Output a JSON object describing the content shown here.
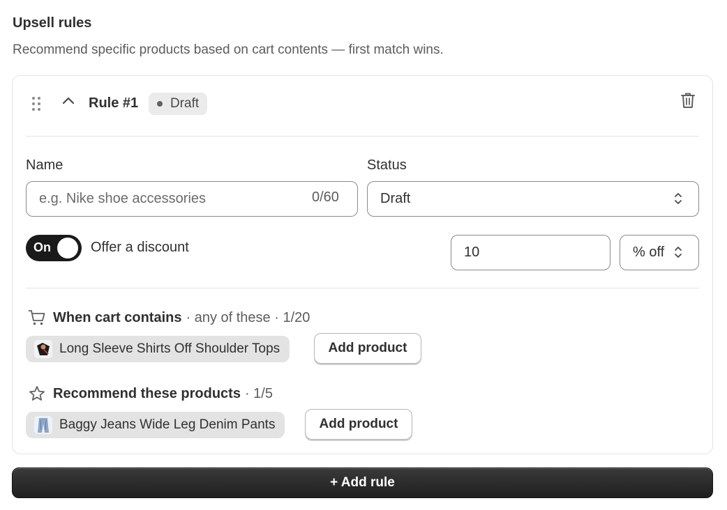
{
  "header": {
    "title": "Upsell rules",
    "subtitle": "Recommend specific products based on cart contents — first match wins."
  },
  "rule": {
    "title": "Rule #1",
    "badge": "Draft",
    "name_label": "Name",
    "name_placeholder": "e.g. Nike shoe accessories",
    "name_counter": "0/60",
    "status_label": "Status",
    "status_value": "Draft",
    "toggle_text": "On",
    "toggle_label": "Offer a discount",
    "discount_value": "10",
    "discount_unit": "% off",
    "cart_section": {
      "title": "When cart contains",
      "meta": "· any of these · 1/20",
      "product": "Long Sleeve Shirts Off Shoulder Tops",
      "add_label": "Add product"
    },
    "recommend_section": {
      "title": "Recommend these products",
      "meta": "· 1/5",
      "product": "Baggy Jeans Wide Leg Denim Pants",
      "add_label": "Add product"
    }
  },
  "footer": {
    "add_rule_label": "+ Add rule"
  },
  "colors": {
    "primary": "#1a1a1a",
    "border": "#e3e3e3",
    "chip_bg": "#e3e3e3",
    "text": "#303030",
    "muted": "#5c5c5c"
  },
  "icons": {
    "drag": "drag-handle-icon",
    "collapse": "chevron-up-icon",
    "delete": "trash-icon",
    "select": "select-arrows-icon",
    "cart": "cart-icon",
    "star": "star-icon"
  }
}
